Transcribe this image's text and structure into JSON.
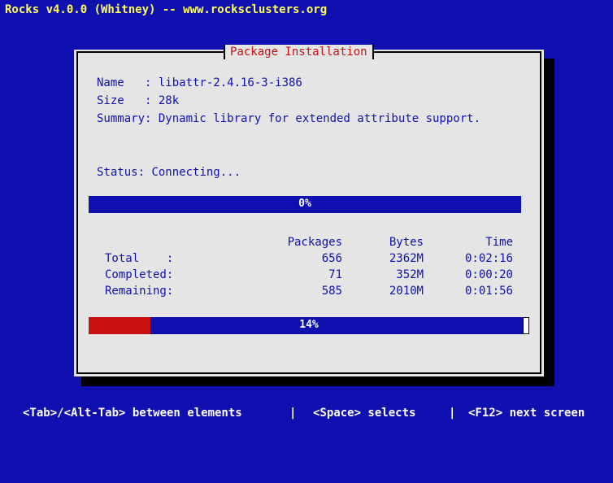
{
  "window": {
    "title": "Rocks v4.0.0 (Whitney) -- www.rocksclusters.org"
  },
  "dialog": {
    "title": "Package Installation",
    "name_label": "Name   : ",
    "name_value": "libattr-2.4.16-3-i386",
    "size_label": "Size   : ",
    "size_value": "28k",
    "summary_label": "Summary: ",
    "summary_value": "Dynamic library for extended attribute support.",
    "status_label": "Status: ",
    "status_value": "Connecting...",
    "package_progress": {
      "percent": 0,
      "label": "0%"
    },
    "table": {
      "headers": [
        "Packages",
        "Bytes",
        "Time"
      ],
      "rows": [
        {
          "label": "Total    :",
          "packages": "656",
          "bytes": "2362M",
          "time": "0:02:16"
        },
        {
          "label": "Completed:",
          "packages": "71",
          "bytes": "352M",
          "time": "0:00:20"
        },
        {
          "label": "Remaining:",
          "packages": "585",
          "bytes": "2010M",
          "time": "0:01:56"
        }
      ]
    },
    "overall_progress": {
      "percent": 14,
      "label": "14%"
    }
  },
  "statusbar": {
    "hint_tab": "<Tab>/<Alt-Tab> between elements",
    "sep1": "|",
    "hint_space": "<Space> selects",
    "sep2": "|",
    "hint_f12": "<F12> next screen"
  },
  "colors": {
    "background": "#1010b0",
    "dialog": "#e5e5e5",
    "title_text": "#c81010",
    "progress_fill": "#c81010",
    "header_text": "#ffff55"
  }
}
